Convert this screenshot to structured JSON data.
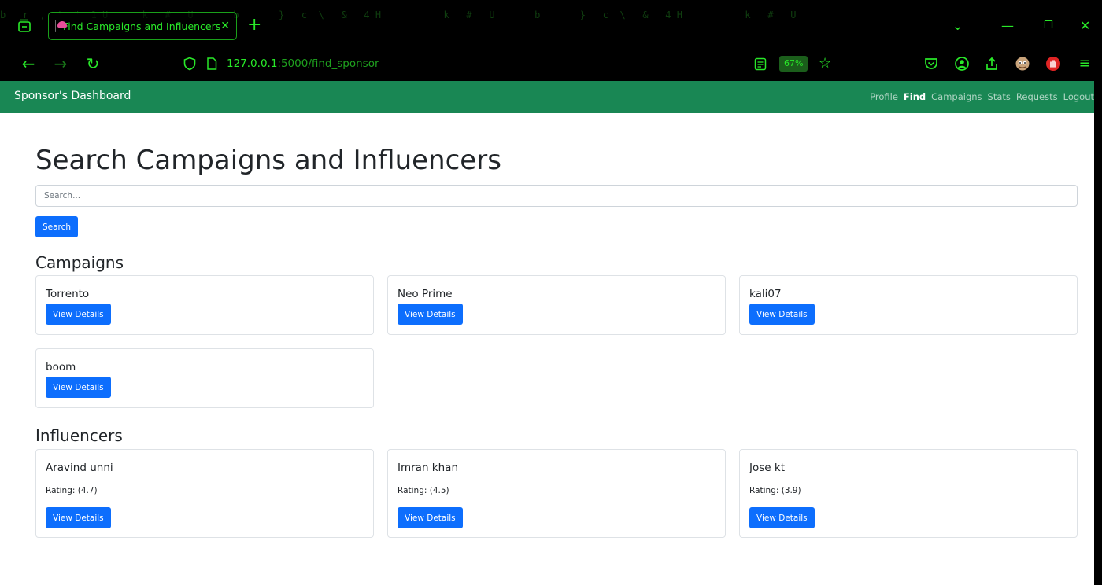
{
  "browser": {
    "tab_title": "Find Campaigns and Influencers",
    "url_host": "127.0.0.1",
    "url_path": ":5000/find_sponsor",
    "zoom": "67%"
  },
  "app": {
    "brand": "Sponsor's Dashboard",
    "nav": [
      {
        "label": "Profile",
        "active": false
      },
      {
        "label": "Find",
        "active": true
      },
      {
        "label": "Campaigns",
        "active": false
      },
      {
        "label": "Stats",
        "active": false
      },
      {
        "label": "Requests",
        "active": false
      },
      {
        "label": "Logout",
        "active": false
      }
    ]
  },
  "page": {
    "title": "Search Campaigns and Influencers",
    "search_placeholder": "Search...",
    "search_button": "Search"
  },
  "campaigns": {
    "heading": "Campaigns",
    "items": [
      {
        "name": "Torrento",
        "button": "View Details"
      },
      {
        "name": "Neo Prime",
        "button": "View Details"
      },
      {
        "name": "kali07",
        "button": "View Details"
      },
      {
        "name": "boom",
        "button": "View Details"
      }
    ]
  },
  "influencers": {
    "heading": "Influencers",
    "items": [
      {
        "name": "Aravind unni",
        "rating": "Rating: (4.7)",
        "button": "View Details"
      },
      {
        "name": "Imran khan",
        "rating": "Rating: (4.5)",
        "button": "View Details"
      },
      {
        "name": "Jose kt",
        "rating": "Rating: (3.9)",
        "button": "View Details"
      }
    ]
  },
  "colors": {
    "header_green": "#198754",
    "primary_blue": "#0d6efd",
    "chrome_green": "#29e829"
  }
}
